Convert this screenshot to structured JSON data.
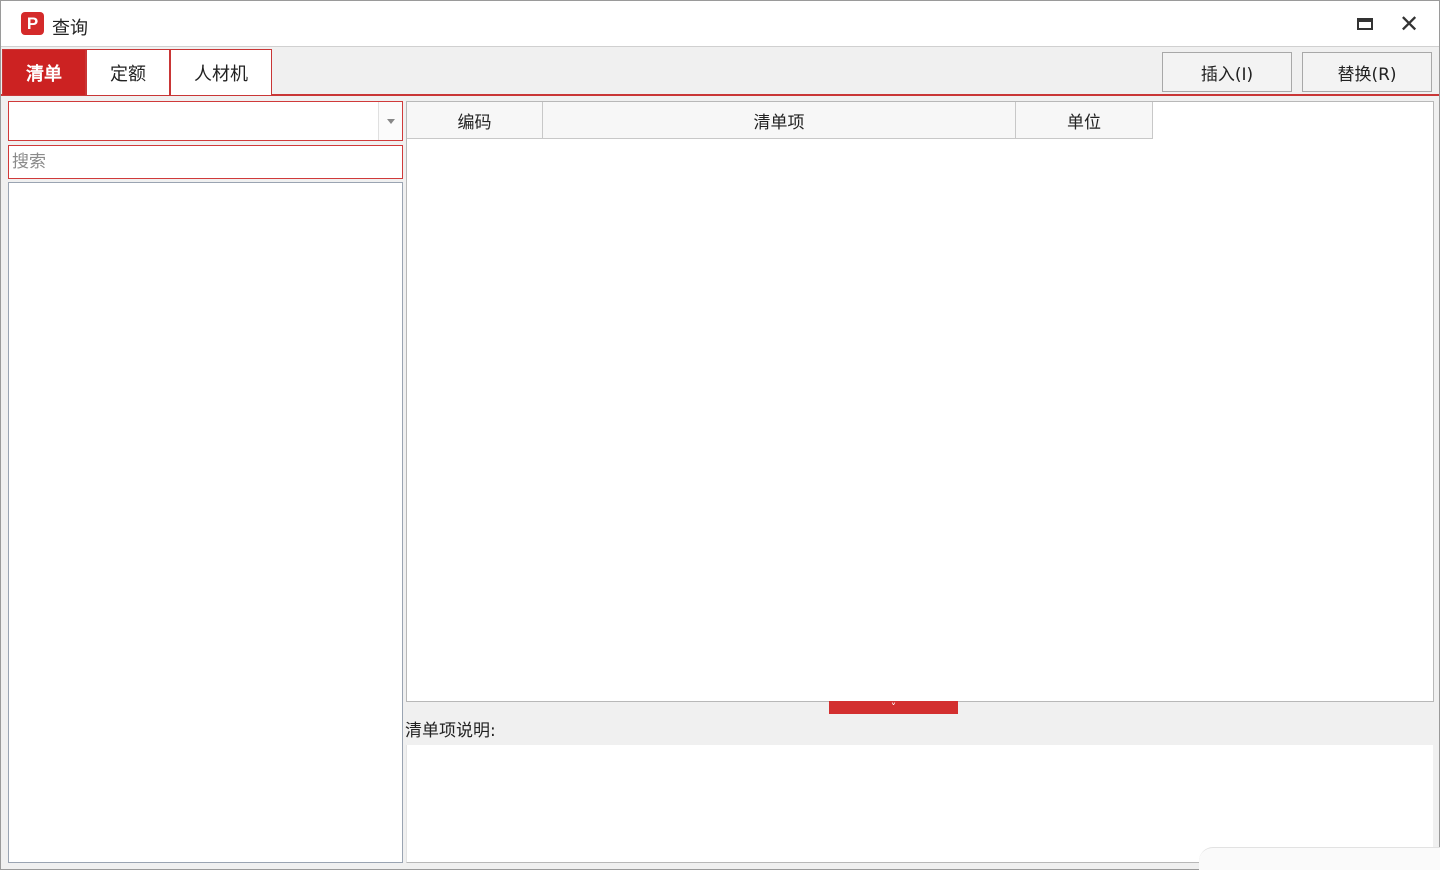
{
  "window": {
    "title": "查询",
    "logo_letter": "P",
    "maximize_icon": "maximize-icon",
    "close_icon": "close-icon",
    "close_glyph": "✕"
  },
  "tabs": [
    {
      "label": "清单",
      "active": true
    },
    {
      "label": "定额",
      "active": false
    },
    {
      "label": "人材机",
      "active": false
    }
  ],
  "actions": {
    "insert_label": "插入(I)",
    "replace_label": "替换(R)"
  },
  "left_panel": {
    "combo_value": "",
    "search_placeholder": "搜索"
  },
  "grid": {
    "columns": [
      "编码",
      "清单项",
      "单位"
    ],
    "rows": []
  },
  "splitter": {
    "icon": "chevron-down-icon",
    "glyph": "˅"
  },
  "description": {
    "label": "清单项说明:",
    "text": ""
  },
  "colors": {
    "accent": "#cc2222",
    "border_accent": "#c93636"
  }
}
